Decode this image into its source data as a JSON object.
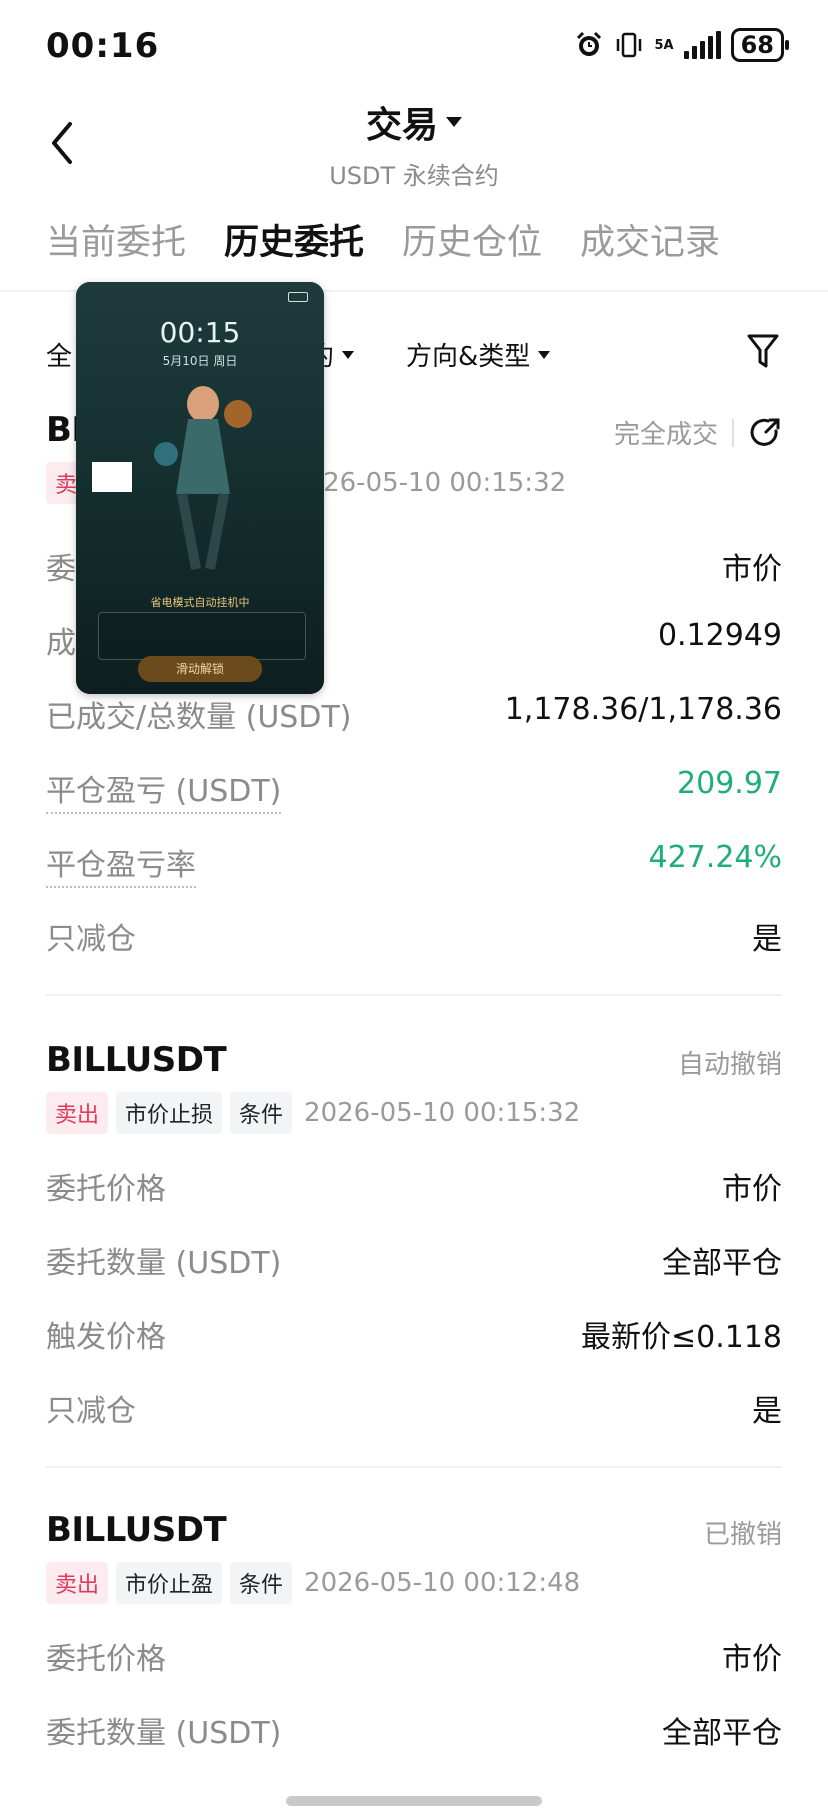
{
  "status_bar": {
    "time": "00:16",
    "network": "5A",
    "battery": "68"
  },
  "header": {
    "title": "交易",
    "subtitle": "USDT 永续合约"
  },
  "tabs": [
    {
      "label": "当前委托",
      "active": false
    },
    {
      "label": "历史委托",
      "active": true
    },
    {
      "label": "历史仓位",
      "active": false
    },
    {
      "label": "成交记录",
      "active": false
    }
  ],
  "filters": {
    "first": "全",
    "second": "约",
    "third": "方向&类型"
  },
  "overlay": {
    "time": "00:15",
    "date": "5月10日  周日",
    "banner": "省电模式自动挂机中",
    "unlock": "滑动解锁"
  },
  "orders": [
    {
      "symbol": "BI",
      "status": "完全成交",
      "tags": [
        "卖"
      ],
      "time": "2026-05-10 00:15:32",
      "rows": [
        {
          "label": "委",
          "value": "市价"
        },
        {
          "label": "成",
          "value": "0.12949"
        },
        {
          "label": "已成交/总数量 (USDT)",
          "value": "1,178.36/1,178.36"
        },
        {
          "label": "平仓盈亏 (USDT)",
          "value": "209.97"
        },
        {
          "label": "平仓盈亏率",
          "value": "427.24%"
        },
        {
          "label": "只减仓",
          "value": "是"
        }
      ]
    },
    {
      "symbol": "BILLUSDT",
      "status": "自动撤销",
      "tags": [
        "卖出",
        "市价止损",
        "条件"
      ],
      "time": "2026-05-10 00:15:32",
      "rows": [
        {
          "label": "委托价格",
          "value": "市价"
        },
        {
          "label": "委托数量 (USDT)",
          "value": "全部平仓"
        },
        {
          "label": "触发价格",
          "value": "最新价≤0.118"
        },
        {
          "label": "只减仓",
          "value": "是"
        }
      ]
    },
    {
      "symbol": "BILLUSDT",
      "status": "已撤销",
      "tags": [
        "卖出",
        "市价止盈",
        "条件"
      ],
      "time": "2026-05-10 00:12:48",
      "rows": [
        {
          "label": "委托价格",
          "value": "市价"
        },
        {
          "label": "委托数量 (USDT)",
          "value": "全部平仓"
        }
      ]
    }
  ],
  "colors": {
    "sell_tag": "#e23a5c",
    "profit_green": "#1fae78"
  },
  "icons": [
    "back-arrow-icon",
    "dropdown-caret-icon",
    "filter-funnel-icon",
    "share-icon",
    "alarm-icon",
    "vibrate-icon",
    "signal-icon",
    "battery-icon"
  ]
}
